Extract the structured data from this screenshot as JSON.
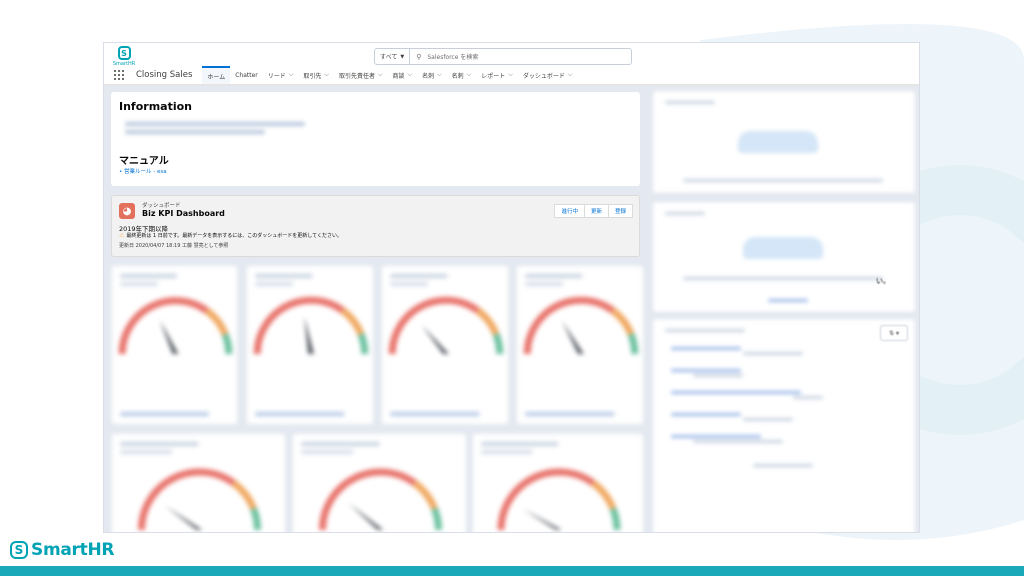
{
  "brand": {
    "name": "SmartHR",
    "icon": "smarthr-logo-icon",
    "color": "#00a3b4",
    "bar_color": "#1aa9b8"
  },
  "salesforce": {
    "logo_text": "SmartHR",
    "search": {
      "scope": "すべて",
      "placeholder": "Salesforce を検索"
    },
    "app_name": "Closing Sales",
    "nav_items": [
      {
        "label": "ホーム",
        "active": true,
        "has_menu": false
      },
      {
        "label": "Chatter",
        "active": false,
        "has_menu": false
      },
      {
        "label": "リード",
        "active": false,
        "has_menu": true
      },
      {
        "label": "取引先",
        "active": false,
        "has_menu": true
      },
      {
        "label": "取引先責任者",
        "active": false,
        "has_menu": true
      },
      {
        "label": "商談",
        "active": false,
        "has_menu": true
      },
      {
        "label": "名刺",
        "active": false,
        "has_menu": true
      },
      {
        "label": "名刺",
        "active": false,
        "has_menu": true
      },
      {
        "label": "レポート",
        "active": false,
        "has_menu": true
      },
      {
        "label": "ダッシュボード",
        "active": false,
        "has_menu": true
      }
    ],
    "information": {
      "title": "Information",
      "manual_title": "マニュアル",
      "manual_items": [
        "営業ルール - esa"
      ]
    },
    "dashboard": {
      "label": "ダッシュボード",
      "title": "Biz KPI Dashboard",
      "period": "2019年下期以降",
      "warning": "最終更新は 1 日前です。最新データを表示するには、このダッシュボードを更新してください。",
      "meta": "更新日 2020/04/07 18:19 工藤 慧亮として参照",
      "buttons": [
        "進行中",
        "更新",
        "登録"
      ]
    },
    "side_text": "い。",
    "side_button": "⇅ ▾"
  }
}
